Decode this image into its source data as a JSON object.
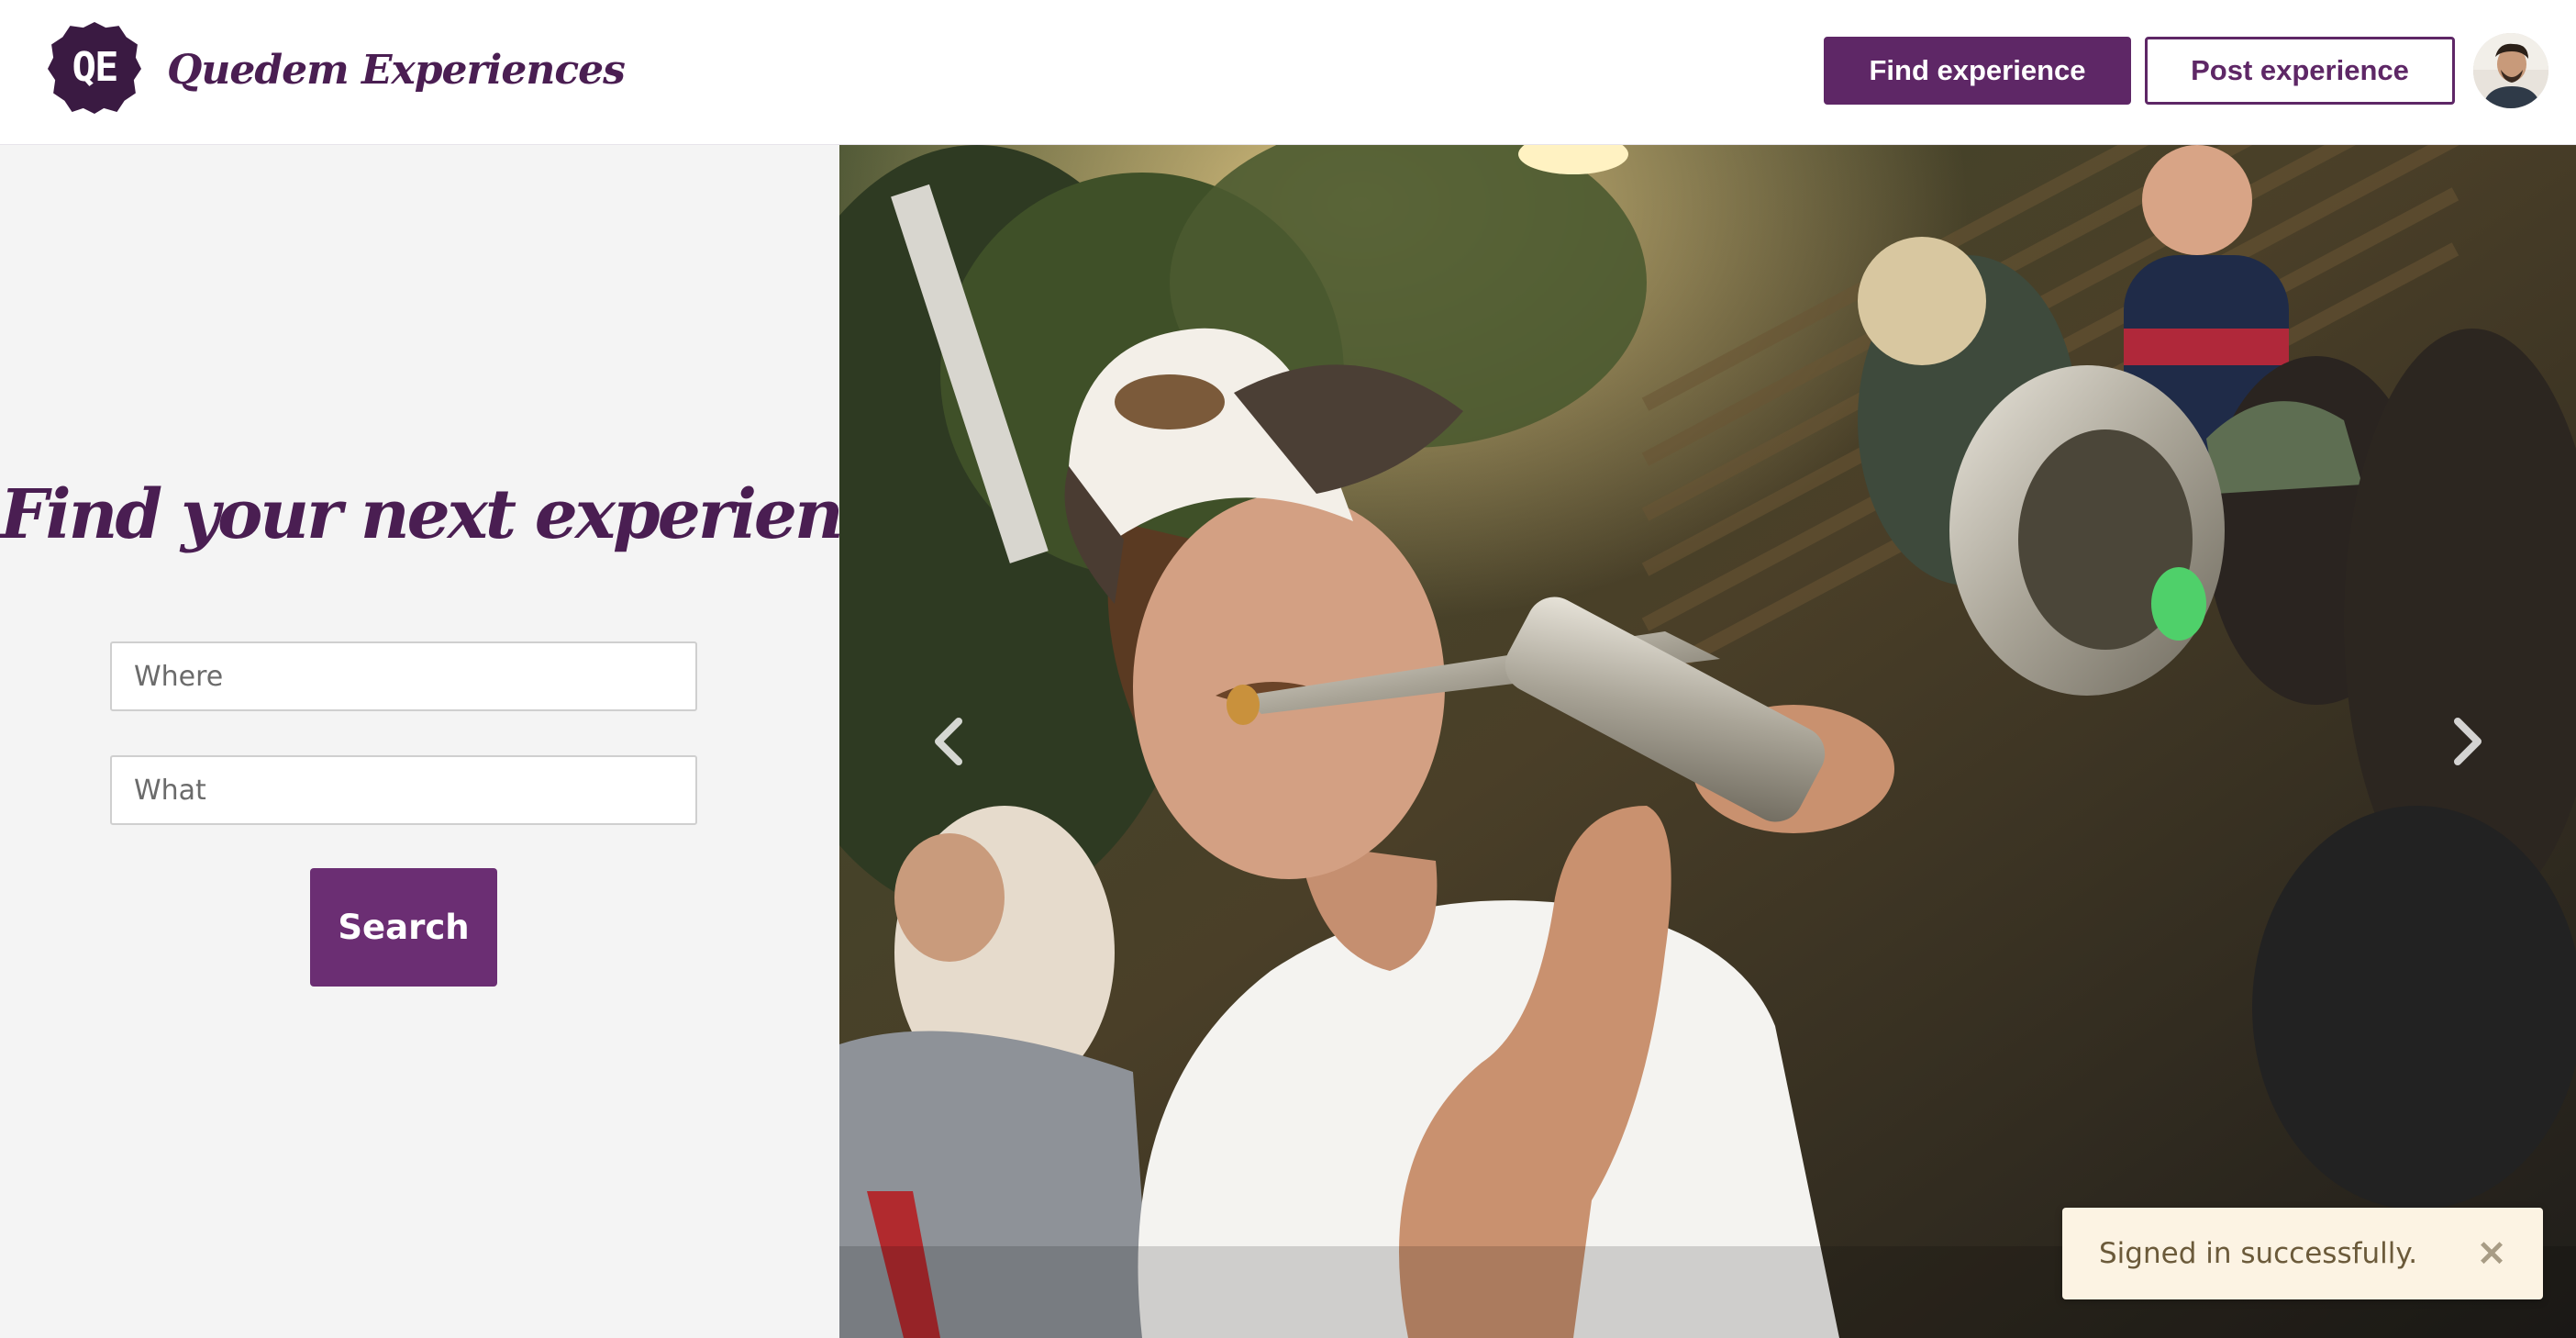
{
  "header": {
    "logo_initials": "QE",
    "brand_name": "Quedem Experiences",
    "find_button": "Find experience",
    "post_button": "Post experience",
    "avatar_icon": "user-avatar"
  },
  "search": {
    "title": "Find your next experience",
    "where_placeholder": "Where",
    "where_value": "",
    "what_placeholder": "What",
    "what_value": "",
    "button_label": "Search"
  },
  "carousel": {
    "image_subject": "trumpet-player-photo",
    "prev_icon": "chevron-left-icon",
    "next_icon": "chevron-right-icon"
  },
  "toast": {
    "message": "Signed in successfully.",
    "close_icon": "close-icon",
    "close_glyph": "✕"
  },
  "colors": {
    "brand_purple": "#5e2766",
    "brand_dark": "#4a1e52",
    "panel_bg": "#f4f4f4",
    "toast_bg": "#fcf3e3"
  }
}
